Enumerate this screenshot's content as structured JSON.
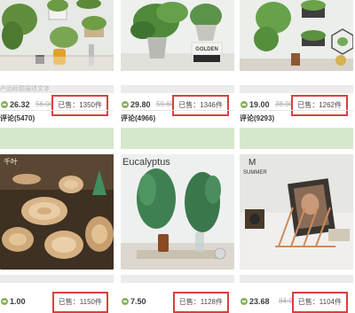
{
  "products": [
    {
      "title": "产品标题描述文字",
      "price": "26.32",
      "old_price": "56.00",
      "sold": "已售：1350件",
      "reviews": "评论(5470)"
    },
    {
      "title": "",
      "price": "29.80",
      "old_price": "59.60",
      "sold": "已售：1346件",
      "reviews": "评论(4966)"
    },
    {
      "title": "",
      "price": "19.00",
      "old_price": "38.00",
      "sold": "已售：1262件",
      "reviews": "评论(9293)"
    },
    {
      "title": "",
      "price": "1.00",
      "old_price": "",
      "sold": "已售：1150件",
      "reviews": ""
    },
    {
      "title": "",
      "price": "7.50",
      "old_price": "",
      "sold": "已售：1128件",
      "reviews": ""
    },
    {
      "title": "",
      "price": "23.68",
      "old_price": "84.00",
      "sold": "已售：1104件",
      "reviews": ""
    }
  ],
  "image_text": {
    "golden_box": "GOLDEN",
    "eucalyptus": "Eucalyptus",
    "summer_m": "M",
    "summer": "SUMMER",
    "wood_label": "千叶"
  },
  "colors": {
    "sold_border": "#d94040",
    "coin": "#88b25a",
    "green_bar": "#d6e8cc"
  }
}
